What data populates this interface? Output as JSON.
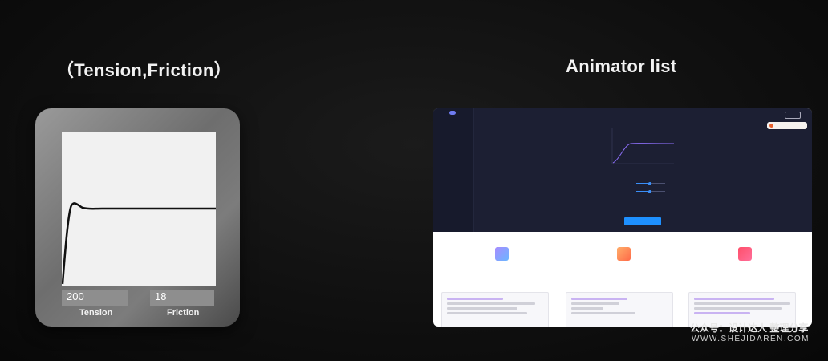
{
  "left": {
    "title": "（Tension,Friction）",
    "tension_value": "200",
    "friction_value": "18",
    "tension_label": "Tension",
    "friction_label": "Friction"
  },
  "right": {
    "title": "Animator list",
    "watermark": "公众号：设计达人 整理分享",
    "watermark_url": "WWW.SHEJIDAREN.COM"
  },
  "colors": {
    "background": "#0f0f0f",
    "card": "#7d7d7d",
    "screenshot_top": "#1c1f33",
    "accent_blue": "#1e90ff"
  }
}
